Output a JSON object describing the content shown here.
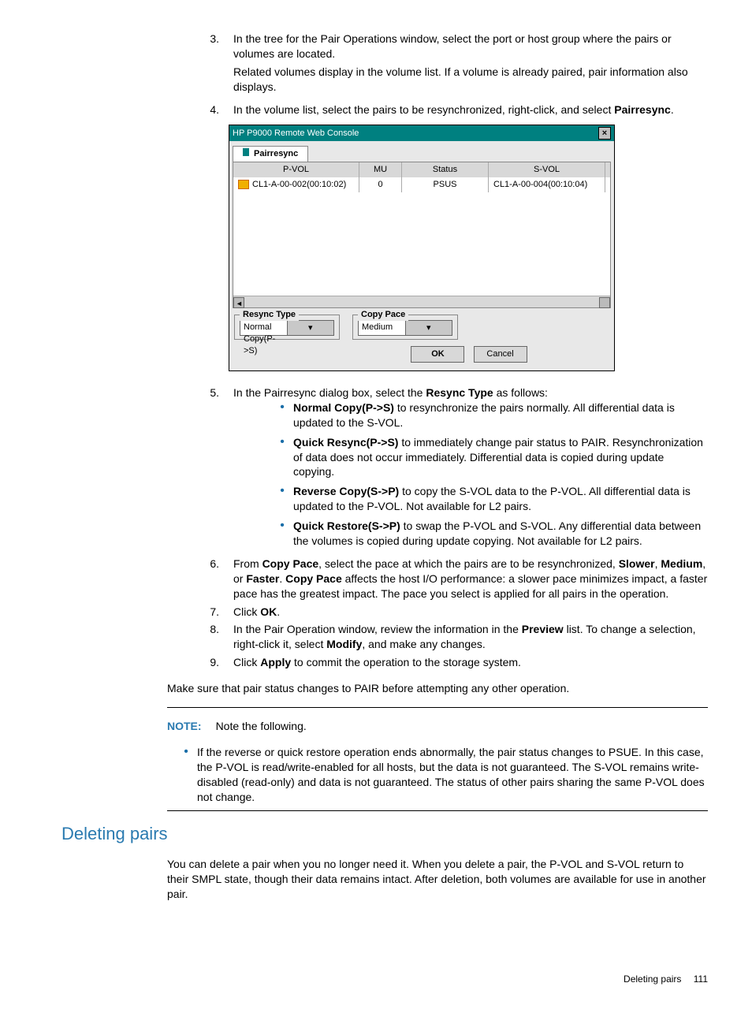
{
  "steps": {
    "s3": {
      "num": "3.",
      "p1": "In the tree for the Pair Operations window, select the port or host group where the pairs or volumes are located.",
      "p2": "Related volumes display in the volume list. If a volume is already paired, pair information also displays."
    },
    "s4": {
      "num": "4.",
      "text_a": "In the volume list, select the pairs to be resynchronized, right-click, and select ",
      "bold": "Pairresync",
      "text_b": "."
    },
    "s5": {
      "num": "5.",
      "text_a": "In the Pairresync dialog box, select the ",
      "bold": "Resync Type",
      "text_b": " as follows:"
    },
    "s5_items": [
      {
        "bold": "Normal Copy(P->S)",
        "rest": " to resynchronize the pairs normally. All differential data is updated to the S-VOL."
      },
      {
        "bold": "Quick Resync(P->S)",
        "rest": " to immediately change pair status to PAIR. Resynchronization of data does not occur immediately. Differential data is copied during update copying."
      },
      {
        "bold": "Reverse Copy(S->P)",
        "rest": " to copy the S-VOL data to the P-VOL. All differential data is updated to the P-VOL. Not available for L2 pairs."
      },
      {
        "bold": "Quick Restore(S->P)",
        "rest": " to swap the P-VOL and S-VOL. Any differential data between the volumes is copied during update copying. Not available for L2 pairs."
      }
    ],
    "s6": {
      "num": "6.",
      "pre": "From ",
      "b1": "Copy Pace",
      "t1": ", select the pace at which the pairs are to be resynchronized, ",
      "b2": "Slower",
      "c1": ", ",
      "b3": "Medium",
      "c2": ", or ",
      "b4": "Faster",
      "c3": ". ",
      "b5": "Copy Pace",
      "tail": " affects the host I/O performance: a slower pace minimizes impact, a faster pace has the greatest impact. The pace you select is applied for all pairs in the operation."
    },
    "s7": {
      "num": "7.",
      "pre": "Click ",
      "bold": "OK",
      "post": "."
    },
    "s8": {
      "num": "8.",
      "pre": "In the Pair Operation window, review the information in the ",
      "b1": "Preview",
      "mid": " list. To change a selection, right-click it, select ",
      "b2": "Modify",
      "post": ", and make any changes."
    },
    "s9": {
      "num": "9.",
      "pre": "Click ",
      "bold": "Apply",
      "post": " to commit the operation to the storage system."
    }
  },
  "after_steps": "Make sure that pair status changes to PAIR before attempting any other operation.",
  "note": {
    "label": "NOTE:",
    "lead": "Note the following.",
    "bullet": "If the reverse or quick restore operation ends abnormally, the pair status changes to PSUE. In this case, the P-VOL is read/write-enabled for all hosts, but the data is not guaranteed. The S-VOL remains write-disabled (read-only) and data is not guaranteed. The status of other pairs sharing the same P-VOL does not change."
  },
  "heading": "Deleting pairs",
  "deleting_body": "You can delete a pair when you no longer need it. When you delete a pair, the P-VOL and S-VOL return to their SMPL state, though their data remains intact. After deletion, both volumes are available for use in another pair.",
  "footer": {
    "text": "Deleting pairs",
    "page": "111"
  },
  "dialog": {
    "title": "HP P9000 Remote Web Console",
    "tab": "Pairresync",
    "headers": {
      "pvol": "P-VOL",
      "mu": "MU",
      "status": "Status",
      "svol": "S-VOL"
    },
    "row": {
      "pvol": "CL1-A-00-002(00:10:02)",
      "mu": "0",
      "status": "PSUS",
      "svol": "CL1-A-00-004(00:10:04)"
    },
    "resync_label": "Resync Type",
    "resync_value": "Normal Copy(P->S)",
    "pace_label": "Copy Pace",
    "pace_value": "Medium",
    "ok": "OK",
    "cancel": "Cancel"
  }
}
